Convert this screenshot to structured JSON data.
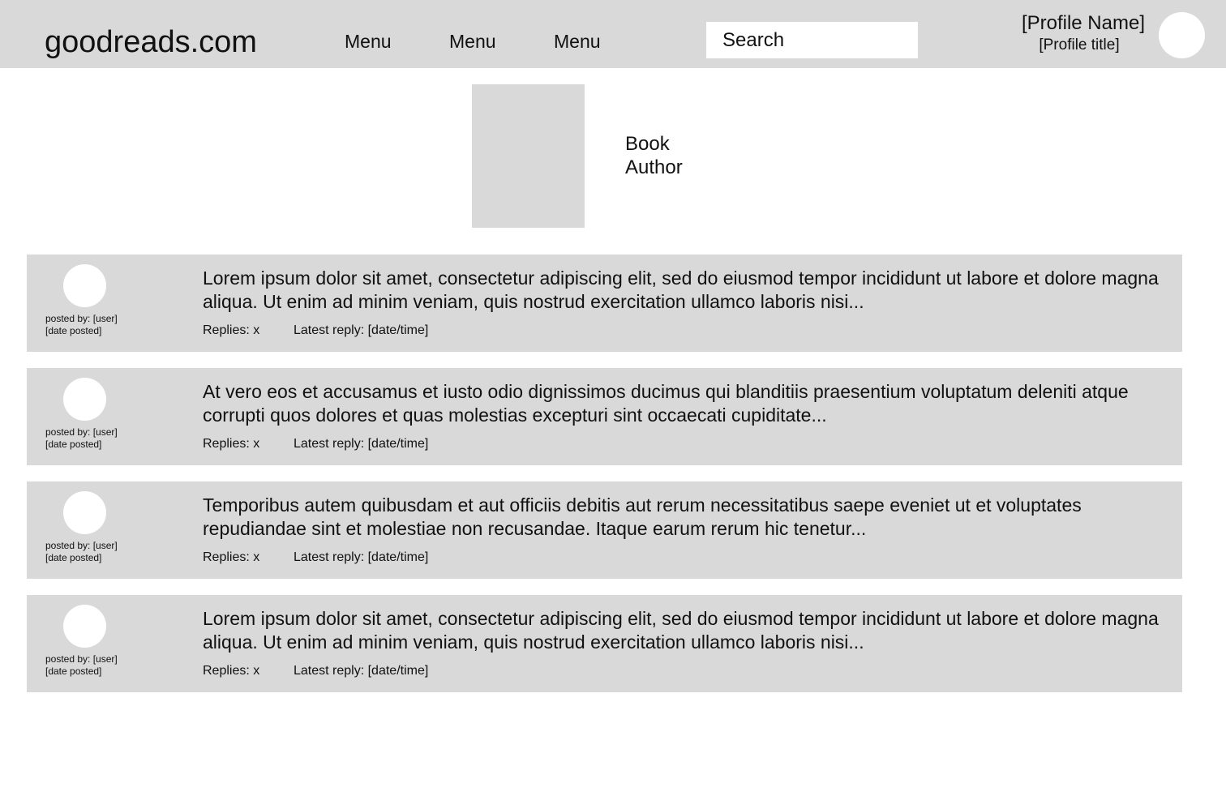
{
  "header": {
    "logo": "goodreads.com",
    "menu": [
      "Menu",
      "Menu",
      "Menu"
    ],
    "search_placeholder": "Search",
    "profile_name": "[Profile Name]",
    "profile_title": "[Profile title]"
  },
  "book": {
    "title": "Book",
    "author": "Author"
  },
  "posts": [
    {
      "posted_by": "posted by: [user]",
      "date_posted": "[date posted]",
      "text": "Lorem ipsum dolor sit amet, consectetur adipiscing elit, sed do eiusmod tempor incididunt ut labore et dolore magna aliqua. Ut enim ad minim veniam, quis nostrud exercitation ullamco laboris nisi...",
      "replies": "Replies: x",
      "latest_reply": "Latest reply: [date/time]"
    },
    {
      "posted_by": "posted by: [user]",
      "date_posted": "[date posted]",
      "text": "At vero eos et accusamus et iusto odio dignissimos ducimus qui blanditiis praesentium voluptatum deleniti atque corrupti quos dolores et quas molestias excepturi sint occaecati cupiditate...",
      "replies": "Replies: x",
      "latest_reply": "Latest reply: [date/time]"
    },
    {
      "posted_by": "posted by: [user]",
      "date_posted": "[date posted]",
      "text": "Temporibus autem quibusdam et aut officiis debitis aut rerum necessitatibus saepe eveniet ut et voluptates repudiandae sint et molestiae non recusandae. Itaque earum rerum hic tenetur...",
      "replies": "Replies: x",
      "latest_reply": "Latest reply: [date/time]"
    },
    {
      "posted_by": "posted by: [user]",
      "date_posted": "[date posted]",
      "text": "Lorem ipsum dolor sit amet, consectetur adipiscing elit, sed do eiusmod tempor incididunt ut labore et dolore magna aliqua. Ut enim ad minim veniam, quis nostrud exercitation ullamco laboris nisi...",
      "replies": "Replies: x",
      "latest_reply": "Latest reply: [date/time]"
    }
  ],
  "colors": {
    "panel_gray": "#d9d9d9",
    "background": "#ffffff",
    "text": "#111111"
  }
}
